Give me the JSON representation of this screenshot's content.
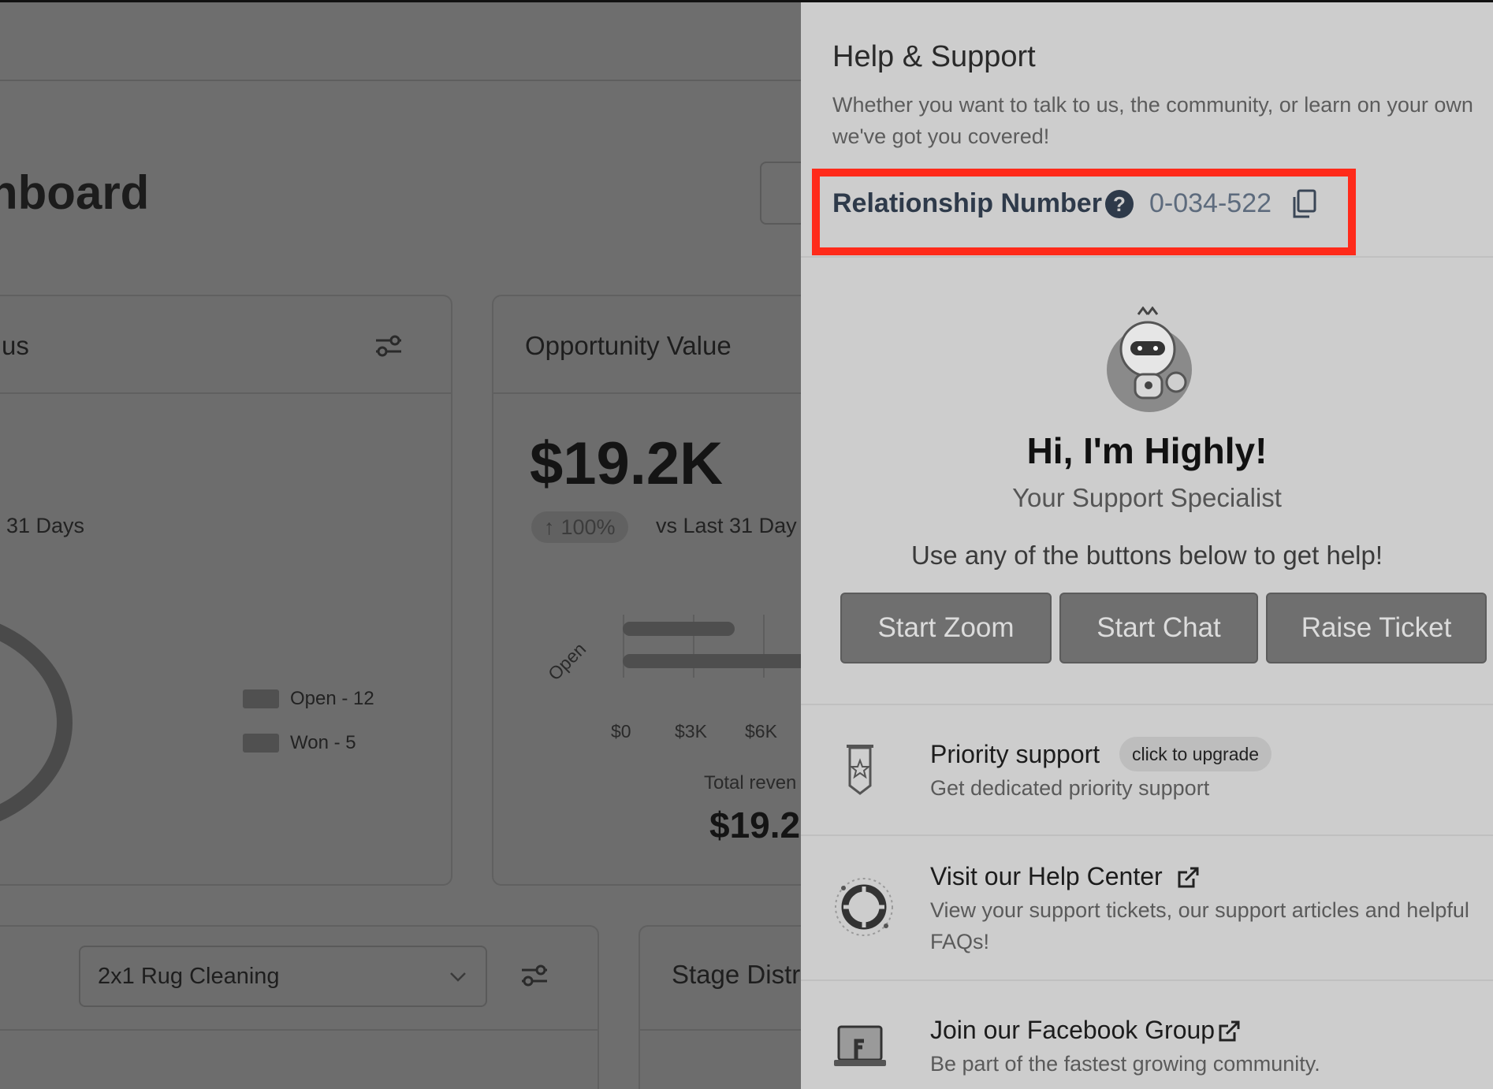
{
  "dashboard": {
    "title": "hboard",
    "status_card": {
      "title": "us",
      "period": "31 Days",
      "legend": [
        {
          "label": "Open - 12"
        },
        {
          "label": "Won - 5"
        }
      ]
    },
    "opportunity_card": {
      "title": "Opportunity Value",
      "value": "$19.2K",
      "change": "100%",
      "change_direction": "up",
      "comparison": "vs Last 31 Day",
      "category_label": "Open",
      "x_ticks": [
        "$0",
        "$3K",
        "$6K"
      ],
      "total_label": "Total reven",
      "total_value": "$19.2"
    },
    "pipeline_select": {
      "value": "2x1 Rug Cleaning"
    },
    "stage_card": {
      "title": "Stage Distr"
    }
  },
  "help_panel": {
    "title": "Help & Support",
    "subtitle": "Whether you want to talk to us, the community, or learn on your own we've got you covered!",
    "relationship": {
      "label": "Relationship Number",
      "help_glyph": "?",
      "number": "0-034-522"
    },
    "assistant": {
      "greeting": "Hi, I'm Highly!",
      "role": "Your Support Specialist",
      "prompt": "Use any of the buttons below to get help!"
    },
    "buttons": [
      {
        "label": "Start Zoom"
      },
      {
        "label": "Start Chat"
      },
      {
        "label": "Raise Ticket"
      }
    ],
    "resources": [
      {
        "icon": "priority-badge-icon",
        "title": "Priority support",
        "badge": "click to upgrade",
        "description": "Get dedicated priority support"
      },
      {
        "icon": "lifebuoy-icon",
        "title": "Visit our Help Center",
        "description": "View your support tickets, our support articles and helpful FAQs!"
      },
      {
        "icon": "facebook-laptop-icon",
        "title": "Join our Facebook Group",
        "description": "Be part of the fastest growing community."
      }
    ]
  },
  "colors": {
    "highlight_border": "#ff2a1a",
    "panel_background": "#cdcdcd",
    "overlay": "#6e6e6e",
    "relationship_text": "#2e3a4a"
  }
}
